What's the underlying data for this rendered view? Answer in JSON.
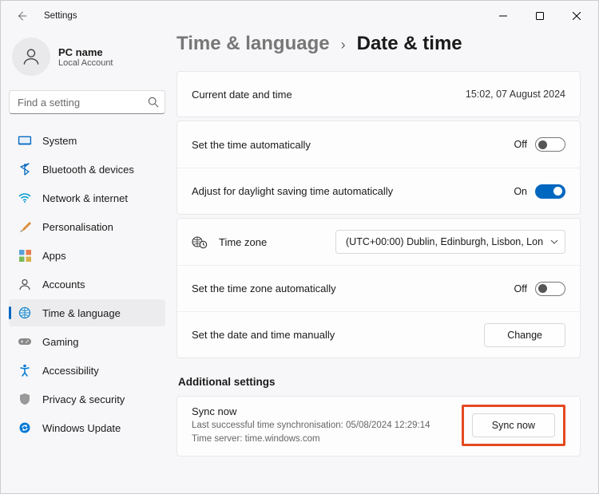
{
  "window": {
    "title": "Settings"
  },
  "account": {
    "name": "PC name",
    "type": "Local Account"
  },
  "search": {
    "placeholder": "Find a setting"
  },
  "sidebar": {
    "items": [
      {
        "label": "System"
      },
      {
        "label": "Bluetooth & devices"
      },
      {
        "label": "Network & internet"
      },
      {
        "label": "Personalisation"
      },
      {
        "label": "Apps"
      },
      {
        "label": "Accounts"
      },
      {
        "label": "Time & language"
      },
      {
        "label": "Gaming"
      },
      {
        "label": "Accessibility"
      },
      {
        "label": "Privacy & security"
      },
      {
        "label": "Windows Update"
      }
    ]
  },
  "breadcrumb": {
    "parent": "Time & language",
    "current": "Date & time"
  },
  "current_dt": {
    "label": "Current date and time",
    "value": "15:02, 07 August 2024"
  },
  "auto_time": {
    "label": "Set the time automatically",
    "state": "Off"
  },
  "dst": {
    "label": "Adjust for daylight saving time automatically",
    "state": "On"
  },
  "timezone": {
    "label": "Time zone",
    "selected": "(UTC+00:00) Dublin, Edinburgh, Lisbon, Lon"
  },
  "auto_tz": {
    "label": "Set the time zone automatically",
    "state": "Off"
  },
  "manual": {
    "label": "Set the date and time manually",
    "button": "Change"
  },
  "additional": {
    "header": "Additional settings"
  },
  "sync": {
    "title": "Sync now",
    "last": "Last successful time synchronisation: 05/08/2024 12:29:14",
    "server": "Time server: time.windows.com",
    "button": "Sync now"
  }
}
